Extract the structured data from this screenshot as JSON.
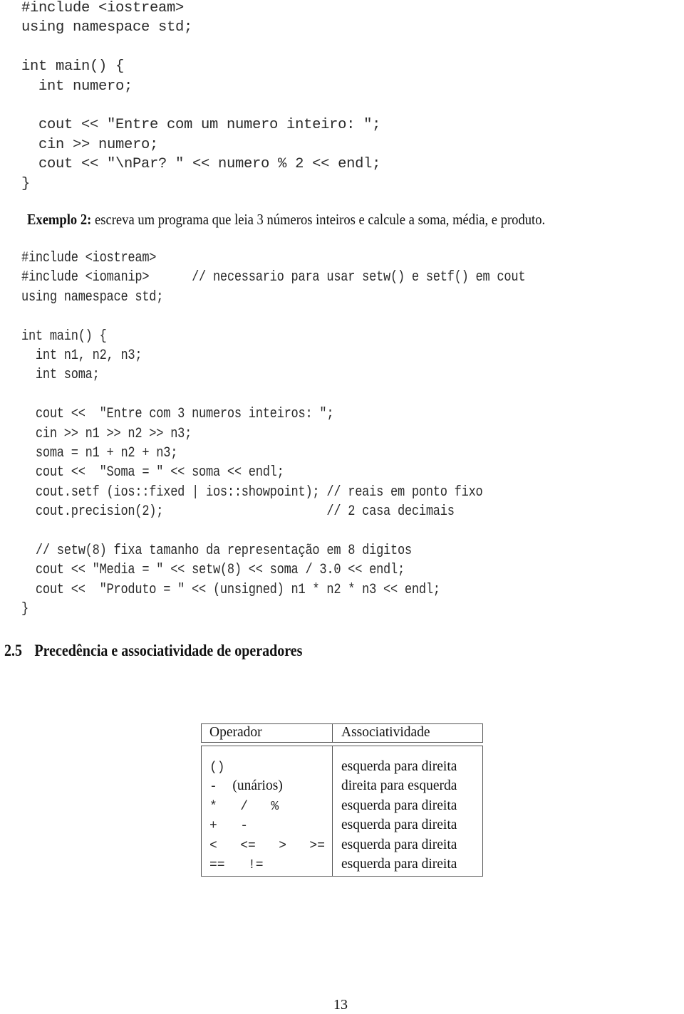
{
  "example1_code": [
    "#include <iostream>",
    "using namespace std;",
    "",
    "int main() {",
    "  int numero;",
    "",
    "  cout << \"Entre com um numero inteiro: \";",
    "  cin >> numero;",
    "  cout << \"\\nPar? \" << numero % 2 << endl;",
    "}"
  ],
  "example2": {
    "label": "Exemplo 2:",
    "description": " escreva um programa que leia 3 números inteiros e calcule a soma, média, e produto."
  },
  "example2_code": [
    "#include <iostream>",
    "#include <iomanip>      // necessario para usar setw() e setf() em cout",
    "using namespace std;",
    "",
    "int main() {",
    "  int n1, n2, n3;",
    "  int soma;",
    "",
    "  cout <<  \"Entre com 3 numeros inteiros: \";",
    "  cin >> n1 >> n2 >> n3;",
    "  soma = n1 + n2 + n3;",
    "  cout <<  \"Soma = \" << soma << endl;",
    "  cout.setf (ios::fixed | ios::showpoint); // reais em ponto fixo",
    "  cout.precision(2);                       // 2 casa decimais",
    "",
    "  // setw(8) fixa tamanho da representação em 8 digitos",
    "  cout << \"Media = \" << setw(8) << soma / 3.0 << endl;",
    "  cout <<  \"Produto = \" << (unsigned) n1 * n2 * n3 << endl;",
    "}"
  ],
  "section": {
    "number": "2.5",
    "title": "Precedência e associatividade de operadores"
  },
  "operator_table": {
    "headers": [
      "Operador",
      "Associatividade"
    ],
    "rows": [
      {
        "operator": "()",
        "operator_note": "",
        "associativity": "esquerda para direita"
      },
      {
        "operator": "-  ",
        "operator_note": "(unários)",
        "associativity": "direita para esquerda"
      },
      {
        "operator": "*   /   %",
        "operator_note": "",
        "associativity": "esquerda para direita"
      },
      {
        "operator": "+   -",
        "operator_note": "",
        "associativity": "esquerda para direita"
      },
      {
        "operator": "<   <=   >   >=",
        "operator_note": "",
        "associativity": "esquerda para direita"
      },
      {
        "operator": "==   !=",
        "operator_note": "",
        "associativity": "esquerda para direita"
      }
    ]
  },
  "page_number": "13"
}
